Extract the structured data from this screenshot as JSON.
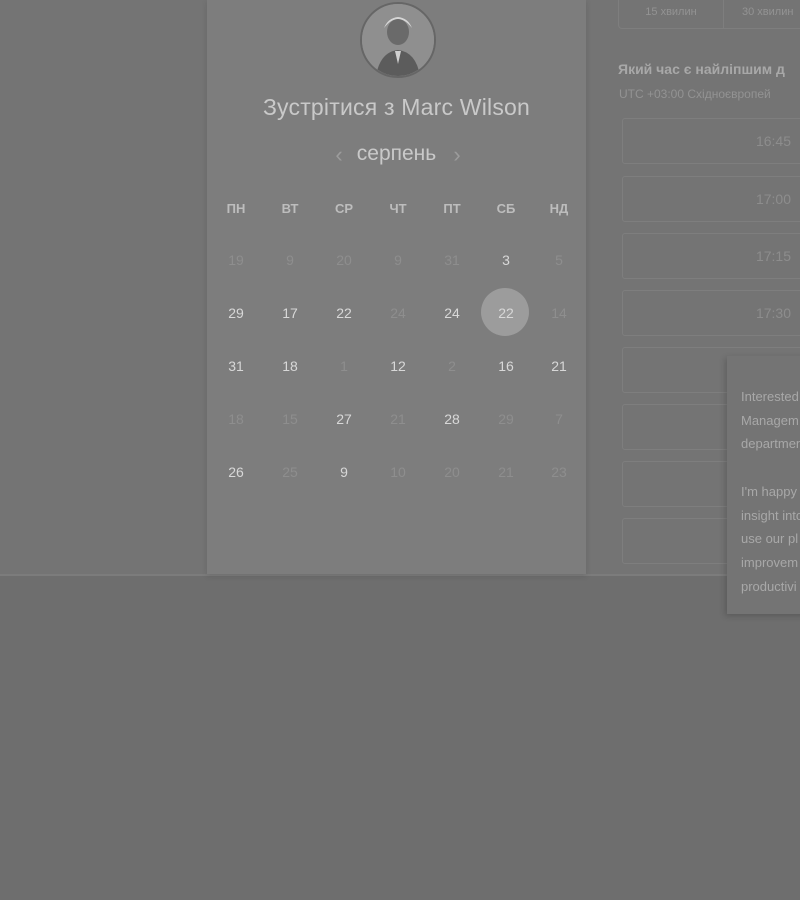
{
  "page": {
    "background": "#6e6e6e"
  },
  "calendar": {
    "title": "Зустрітися з Marc Wilson",
    "month": "серпень",
    "prev_icon": "chevron-left",
    "next_icon": "chevron-right",
    "weekdays": [
      "ПН",
      "ВТ",
      "СР",
      "ЧТ",
      "ПТ",
      "СБ",
      "НД"
    ],
    "weeks": [
      [
        {
          "d": "19",
          "on": false
        },
        {
          "d": "9",
          "on": false
        },
        {
          "d": "20",
          "on": false
        },
        {
          "d": "9",
          "on": false
        },
        {
          "d": "31",
          "on": false
        },
        {
          "d": "3",
          "on": true
        },
        {
          "d": "5",
          "on": false
        }
      ],
      [
        {
          "d": "29",
          "on": true
        },
        {
          "d": "17",
          "on": true
        },
        {
          "d": "22",
          "on": true
        },
        {
          "d": "24",
          "on": false
        },
        {
          "d": "24",
          "on": true
        },
        {
          "d": "22",
          "on": true,
          "selected": true
        },
        {
          "d": "14",
          "on": false
        }
      ],
      [
        {
          "d": "31",
          "on": true
        },
        {
          "d": "18",
          "on": true
        },
        {
          "d": "1",
          "on": false
        },
        {
          "d": "12",
          "on": true
        },
        {
          "d": "2",
          "on": false
        },
        {
          "d": "16",
          "on": true
        },
        {
          "d": "21",
          "on": true
        }
      ],
      [
        {
          "d": "18",
          "on": false
        },
        {
          "d": "15",
          "on": false
        },
        {
          "d": "27",
          "on": true
        },
        {
          "d": "21",
          "on": false
        },
        {
          "d": "28",
          "on": true
        },
        {
          "d": "29",
          "on": false
        },
        {
          "d": "7",
          "on": false
        }
      ],
      [
        {
          "d": "26",
          "on": true
        },
        {
          "d": "25",
          "on": false
        },
        {
          "d": "9",
          "on": true
        },
        {
          "d": "10",
          "on": false
        },
        {
          "d": "20",
          "on": false
        },
        {
          "d": "21",
          "on": false
        },
        {
          "d": "23",
          "on": false
        }
      ]
    ]
  },
  "duration_tabs": [
    "15 хвилин",
    "30 хвилин"
  ],
  "best_time_heading": "Який час є найліпшим д",
  "timezone": "UTC +03:00 Східноєвропей",
  "time_slots": [
    "16:45",
    "17:00",
    "17:15",
    "17:30",
    "",
    "",
    "",
    ""
  ],
  "tooltip_lines": [
    "Interested",
    "Managem",
    "departmen",
    "",
    "I'm happy",
    "insight into",
    "use our pl",
    "improvem",
    "productivi"
  ]
}
